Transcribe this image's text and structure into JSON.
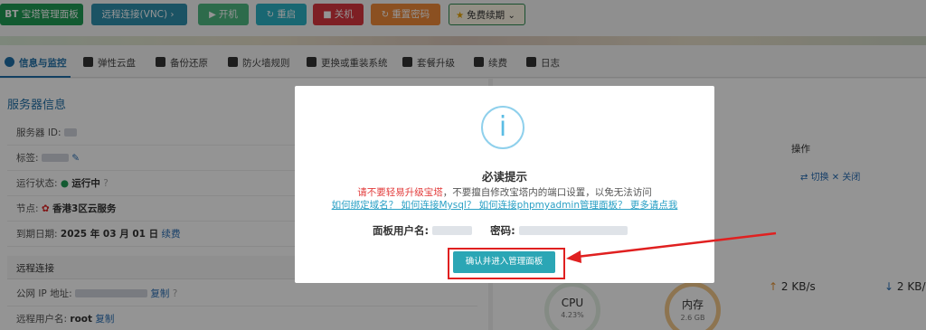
{
  "toolbar": {
    "bt_panel": "宝塔管理面板",
    "bt_prefix": "BT",
    "remote_vnc": "远程连接(VNC)",
    "power_on": "开机",
    "restart": "重启",
    "shutdown": "关机",
    "reset_password": "重置密码",
    "free_renew": "免费续期"
  },
  "tabs": [
    {
      "label": "信息与监控"
    },
    {
      "label": "弹性云盘"
    },
    {
      "label": "备份还原"
    },
    {
      "label": "防火墙规则"
    },
    {
      "label": "更换或重装系统"
    },
    {
      "label": "套餐升级"
    },
    {
      "label": "续费"
    },
    {
      "label": "日志"
    }
  ],
  "server_info": {
    "title": "服务器信息",
    "id_label": "服务器 ID:",
    "tag_label": "标签:",
    "status_label": "运行状态:",
    "status_value": "运行中",
    "node_label": "节点:",
    "node_value": "香港3区云服务",
    "expire_label": "到期日期:",
    "expire_value": "2025 年 03 月 01 日",
    "renew_link": "续费"
  },
  "remote": {
    "title": "远程连接",
    "ip_label": "公网 IP 地址:",
    "copy": "复制",
    "user_label": "远程用户名:",
    "user_value": "root",
    "copy2": "复制"
  },
  "right_panel": {
    "op_header": "操作",
    "switch_link": "切换",
    "close_link": "关闭",
    "upload": "2 KB/s",
    "download": "2 KB/s",
    "cpu_label": "CPU",
    "cpu_value": "4.23%",
    "mem_label": "内存",
    "mem_value": "2.6 GB"
  },
  "modal": {
    "icon": "i",
    "title": "必读提示",
    "warn_red": "请不要轻易升级宝塔",
    "warn_rest": "，不要擅自修改宝塔内的端口设置，以免无法访问",
    "help_links": "如何绑定域名？ 如何连接Mysql？ 如何连接phpmyadmin管理面板？ 更多请点我",
    "user_label": "面板用户名:",
    "pass_label": "密码:",
    "confirm": "确认并进入管理面板"
  },
  "colors": {
    "accent": "#1f6fa8",
    "confirm_button": "#2ba6b5",
    "annotation_red": "#e02020"
  }
}
